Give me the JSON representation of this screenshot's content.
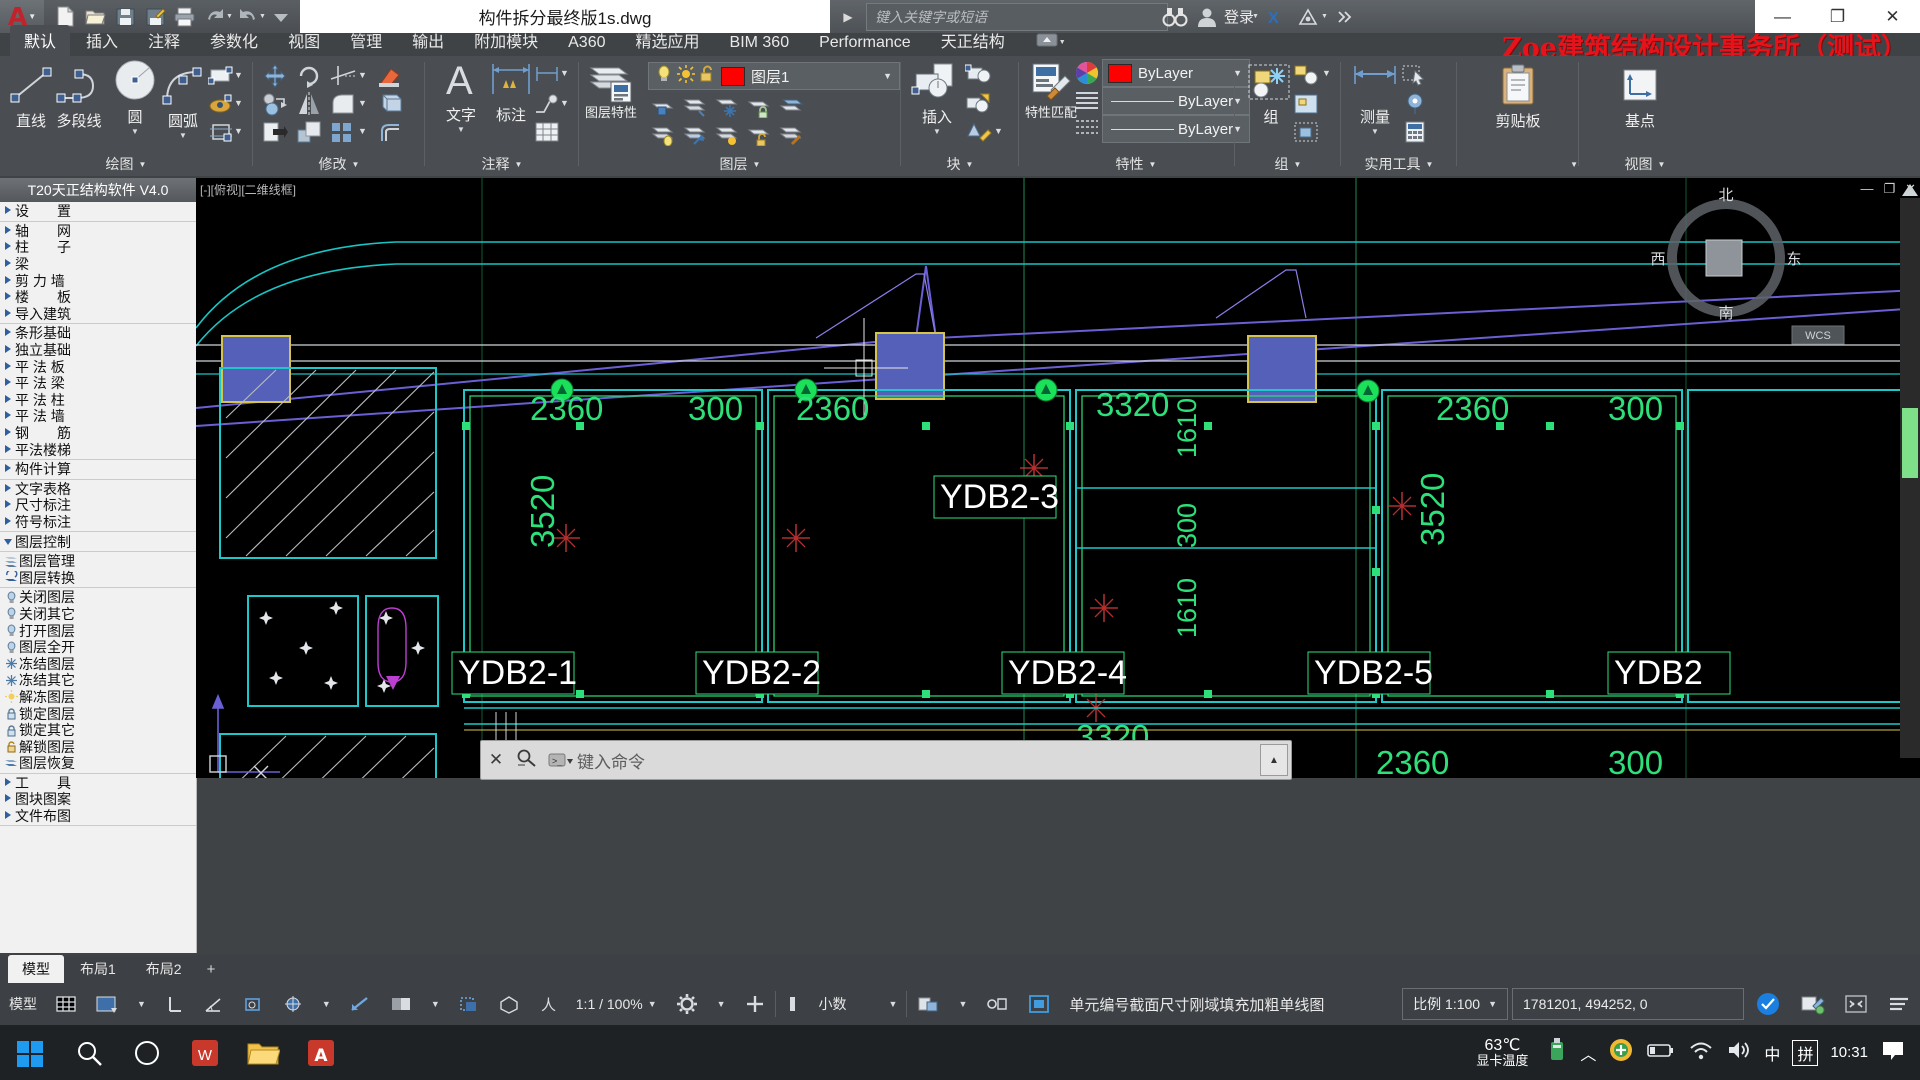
{
  "titlebar": {
    "document_title": "构件拆分最终版1s.dwg",
    "search_placeholder": "键入关键字或短语",
    "signin_label": "登录",
    "quick_access": [
      "new-file-icon",
      "open-folder-icon",
      "save-icon",
      "save-as-icon",
      "plot-icon",
      "undo-icon",
      "redo-icon",
      "customize-icon"
    ],
    "window_buttons": [
      "minimize-icon",
      "restore-icon",
      "close-icon"
    ],
    "watermark": "Zoe建筑结构设计事务所（测试）"
  },
  "ribbon": {
    "tabs": [
      {
        "label": "默认",
        "active": true
      },
      {
        "label": "插入",
        "active": false
      },
      {
        "label": "注释",
        "active": false
      },
      {
        "label": "参数化",
        "active": false
      },
      {
        "label": "视图",
        "active": false
      },
      {
        "label": "管理",
        "active": false
      },
      {
        "label": "输出",
        "active": false
      },
      {
        "label": "附加模块",
        "active": false
      },
      {
        "label": "A360",
        "active": false
      },
      {
        "label": "精选应用",
        "active": false
      },
      {
        "label": "BIM 360",
        "active": false
      },
      {
        "label": "Performance",
        "active": false
      },
      {
        "label": "天正结构",
        "active": false
      }
    ],
    "panels": {
      "draw": {
        "title": "绘图",
        "buttons": [
          {
            "label": "直线",
            "icon": "line-icon"
          },
          {
            "label": "多段线",
            "icon": "polyline-icon"
          },
          {
            "label": "圆",
            "icon": "circle-icon"
          },
          {
            "label": "圆弧",
            "icon": "arc-icon"
          }
        ],
        "small_icons": [
          "rectangle-icon",
          "hatch-icon",
          "crop-icon"
        ]
      },
      "modify": {
        "title": "修改",
        "small_icons": [
          "move-icon",
          "rotate-icon",
          "trim-icon",
          "erase-icon",
          "copy-icon",
          "mirror-icon",
          "fillet-icon",
          "explode-icon",
          "stretch-icon",
          "scale-icon",
          "array-icon",
          "offset-icon"
        ]
      },
      "annotate": {
        "title": "注释",
        "buttons": [
          {
            "label": "文字",
            "icon": "text-icon"
          },
          {
            "label": "标注",
            "icon": "dimension-icon"
          }
        ],
        "small_icons": [
          "linear-dim-icon",
          "leader-icon",
          "table-icon"
        ]
      },
      "layers": {
        "title": "图层",
        "main_label": "图层特性",
        "layer_name": "图层1",
        "layer_color": "#ff0000",
        "toggle_icons": [
          "lightbulb-icon",
          "sun-icon",
          "unlock-icon"
        ],
        "small_icons": [
          "layer-isolate-icon",
          "layer-off-icon",
          "layer-freeze-icon",
          "layer-lock-icon",
          "layer-merge-icon",
          "layer-on-icon",
          "layer-unisolate-icon",
          "layer-thaw-icon",
          "layer-unlock-icon",
          "layer-match-icon"
        ]
      },
      "block": {
        "title": "块",
        "main_label": "插入",
        "small_icons": [
          "create-block-icon",
          "edit-block-icon",
          "block-attribute-icon"
        ]
      },
      "properties": {
        "title": "特性",
        "main_label": "特性匹配",
        "color_value": "ByLayer",
        "color_swatch": "#ff0000",
        "linetype_value": "ByLayer",
        "lineweight_value": "ByLayer"
      },
      "groups": {
        "title": "组",
        "main_label": "组",
        "small_icons": [
          "ungroup-icon",
          "group-edit-icon",
          "group-select-icon"
        ]
      },
      "utilities": {
        "title": "实用工具",
        "main_label": "测量",
        "small_icons": [
          "quick-select-icon",
          "calculator-icon",
          "id-point-icon"
        ]
      },
      "clipboard": {
        "title": "",
        "main_label": "剪贴板",
        "icon": "clipboard-icon"
      },
      "view": {
        "title": "视图",
        "main_label": "基点",
        "icon": "ucs-icon"
      }
    }
  },
  "sidebar": {
    "header": "T20天正结构软件 V4.0",
    "groups": [
      {
        "items": [
          {
            "label": "设　　置",
            "type": "tree",
            "icon": "expand-arrow-icon"
          }
        ]
      },
      {
        "items": [
          {
            "label": "轴　　网",
            "type": "tree",
            "icon": "expand-arrow-icon"
          },
          {
            "label": "柱　　子",
            "type": "tree",
            "icon": "expand-arrow-icon"
          },
          {
            "label": "梁",
            "type": "tree",
            "icon": "expand-arrow-icon"
          },
          {
            "label": "剪 力 墙",
            "type": "tree",
            "icon": "expand-arrow-icon"
          },
          {
            "label": "楼　　板",
            "type": "tree",
            "icon": "expand-arrow-icon"
          },
          {
            "label": "导入建筑",
            "type": "tree",
            "icon": "expand-arrow-icon"
          }
        ]
      },
      {
        "items": [
          {
            "label": "条形基础",
            "type": "tree",
            "icon": "expand-arrow-icon"
          },
          {
            "label": "独立基础",
            "type": "tree",
            "icon": "expand-arrow-icon"
          },
          {
            "label": "平 法 板",
            "type": "tree",
            "icon": "expand-arrow-icon"
          },
          {
            "label": "平 法 梁",
            "type": "tree",
            "icon": "expand-arrow-icon"
          },
          {
            "label": "平 法 柱",
            "type": "tree",
            "icon": "expand-arrow-icon"
          },
          {
            "label": "平 法 墙",
            "type": "tree",
            "icon": "expand-arrow-icon"
          },
          {
            "label": "钢　　筋",
            "type": "tree",
            "icon": "expand-arrow-icon"
          },
          {
            "label": "平法楼梯",
            "type": "tree",
            "icon": "expand-arrow-icon"
          }
        ]
      },
      {
        "items": [
          {
            "label": "构件计算",
            "type": "tree",
            "icon": "expand-arrow-icon"
          }
        ]
      },
      {
        "items": [
          {
            "label": "文字表格",
            "type": "tree",
            "icon": "expand-arrow-icon"
          },
          {
            "label": "尺寸标注",
            "type": "tree",
            "icon": "expand-arrow-icon"
          },
          {
            "label": "符号标注",
            "type": "tree",
            "icon": "expand-arrow-icon"
          }
        ]
      },
      {
        "items": [
          {
            "label": "图层控制",
            "type": "tree-open",
            "icon": "collapse-arrow-icon"
          }
        ]
      },
      {
        "items": [
          {
            "label": "图层管理",
            "type": "cmd",
            "icon": "layers-stack-icon"
          },
          {
            "label": "图层转换",
            "type": "cmd",
            "icon": "layer-convert-icon"
          }
        ]
      },
      {
        "items": [
          {
            "label": "关闭图层",
            "type": "cmd",
            "icon": "lightbulb-off-icon"
          },
          {
            "label": "关闭其它",
            "type": "cmd",
            "icon": "lightbulb-others-icon"
          },
          {
            "label": "打开图层",
            "type": "cmd",
            "icon": "lightbulb-on-icon"
          },
          {
            "label": "图层全开",
            "type": "cmd",
            "icon": "lightbulb-all-icon"
          },
          {
            "label": "冻结图层",
            "type": "cmd",
            "icon": "snowflake-icon"
          },
          {
            "label": "冻结其它",
            "type": "cmd",
            "icon": "snowflake-others-icon"
          },
          {
            "label": "解冻图层",
            "type": "cmd",
            "icon": "thaw-icon"
          },
          {
            "label": "锁定图层",
            "type": "cmd",
            "icon": "lock-icon"
          },
          {
            "label": "锁定其它",
            "type": "cmd",
            "icon": "lock-others-icon"
          },
          {
            "label": "解锁图层",
            "type": "cmd",
            "icon": "unlock-icon"
          },
          {
            "label": "图层恢复",
            "type": "cmd",
            "icon": "layer-restore-icon"
          }
        ]
      },
      {
        "items": [
          {
            "label": "工　　具",
            "type": "tree",
            "icon": "expand-arrow-icon"
          },
          {
            "label": "图块图案",
            "type": "tree",
            "icon": "expand-arrow-icon"
          },
          {
            "label": "文件布图",
            "type": "tree",
            "icon": "expand-arrow-icon"
          }
        ]
      }
    ]
  },
  "viewport": {
    "label": "[-][俯视][二维线框]",
    "navcube": {
      "north": "北",
      "south": "南",
      "east": "东",
      "west": "西"
    },
    "ucs_label": "WCS",
    "drawing": {
      "slab_labels": [
        "YDB2-1",
        "YDB2-2",
        "YDB2-3",
        "YDB2-4",
        "YDB2-5",
        "YDB2"
      ],
      "dimensions_top": [
        "2360",
        "300",
        "2360",
        "3320",
        "2360",
        "300"
      ],
      "dimensions_left": [
        "3520",
        "3520"
      ],
      "dimensions_right": [
        "1610",
        "300",
        "1610"
      ],
      "dimensions_bottom": [
        "3320",
        "2360",
        "2360",
        "300"
      ]
    }
  },
  "command_line": {
    "placeholder": "键入命令",
    "close_icon": "close-icon",
    "search_icon": "magnifier-icon",
    "history_icon": "history-icon"
  },
  "layout_tabs": [
    {
      "label": "模型",
      "active": true
    },
    {
      "label": "布局1",
      "active": false
    },
    {
      "label": "布局2",
      "active": false
    },
    {
      "label": "+",
      "active": false
    }
  ],
  "status_bar": {
    "model_label": "模型",
    "left_icons": [
      "grid-icon",
      "snap-icon",
      "ortho-icon",
      "polar-icon",
      "osnap-icon",
      "otrack-icon",
      "dynucs-icon",
      "dyninput-icon",
      "lineweight-icon",
      "transparency-icon",
      "selection-cycling-icon",
      "3dosnap-icon",
      "annotation-visibility-icon",
      "autoscale-icon"
    ],
    "annotation_scale": "1:1 / 100%",
    "units_label": "小数",
    "workspace_icon": "gear-icon",
    "add_icon": "plus-icon",
    "tool_label": "单元编号截面尺寸刚域填充加粗单线图",
    "scale_label": "比例 1:100",
    "coordinates": "1781201, 494252, 0",
    "right_icons": [
      "clean-screen-icon",
      "customization-icon",
      "hamburger-icon"
    ]
  },
  "taskbar": {
    "start_icon": "windows-start-icon",
    "apps": [
      "search-icon",
      "task-view-icon",
      "wps-icon",
      "file-explorer-icon",
      "autocad-icon"
    ],
    "temperature": "63℃",
    "temperature_label": "显卡温度",
    "tray_icons": [
      "usb-icon",
      "chevron-up-icon",
      "security-icon",
      "battery-icon",
      "wifi-icon",
      "volume-icon"
    ],
    "ime_mode": "中",
    "ime_type": "拼",
    "clock": "10:31",
    "notification_icon": "notification-icon"
  }
}
